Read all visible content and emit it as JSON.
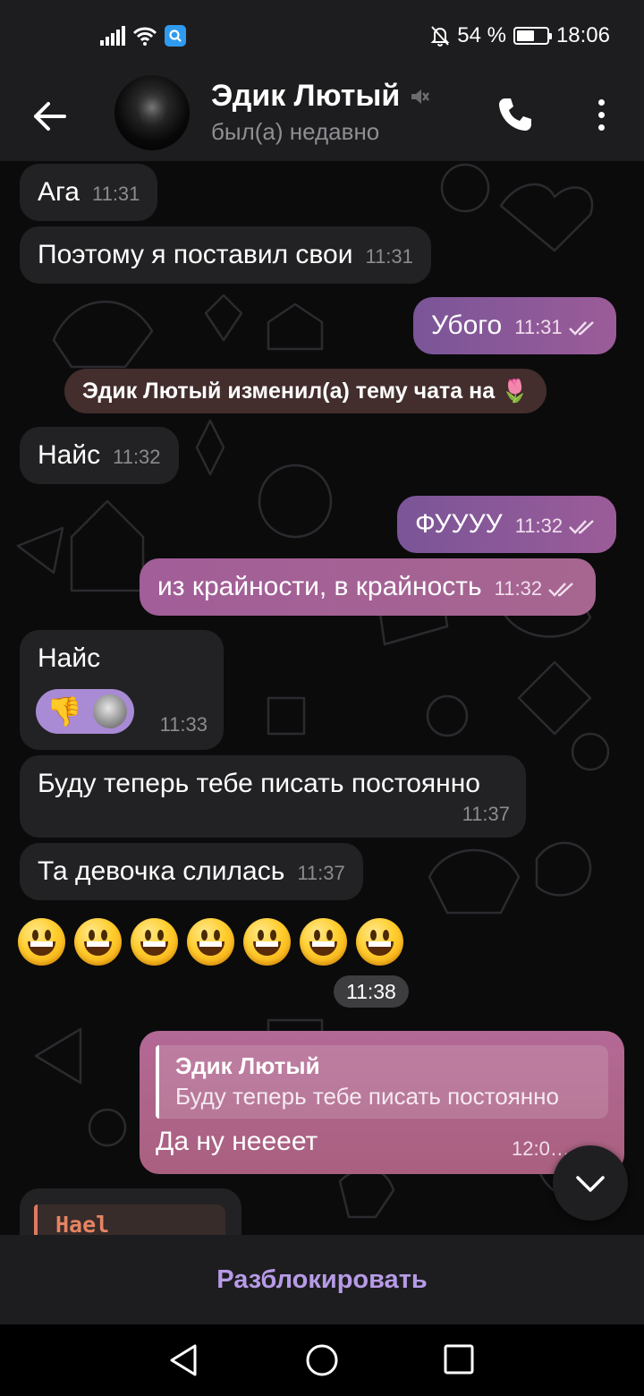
{
  "status_bar": {
    "battery_percent": "54 %",
    "time": "18:06"
  },
  "header": {
    "contact_name": "Эдик Лютый",
    "contact_status": "был(а) недавно",
    "muted": true
  },
  "messages": [
    {
      "dir": "in",
      "text": "Ага",
      "time": "11:31"
    },
    {
      "dir": "in",
      "text": "Поэтому я поставил свои",
      "time": "11:31"
    },
    {
      "dir": "out",
      "text": "Убого",
      "time": "11:31",
      "read": true
    },
    {
      "type": "service",
      "text": "Эдик Лютый изменил(а) тему чата на 🌷"
    },
    {
      "dir": "in",
      "text": "Найс",
      "time": "11:32"
    },
    {
      "dir": "out",
      "text": "ФУУУУ",
      "time": "11:32",
      "read": true
    },
    {
      "dir": "out",
      "text": "из крайности, в крайность",
      "time": "11:32",
      "read": true
    },
    {
      "dir": "in",
      "text": "Найс",
      "time": "11:33",
      "reaction": "👎"
    },
    {
      "dir": "in",
      "text": "Буду теперь тебе писать постоянно",
      "time": "11:37"
    },
    {
      "dir": "in",
      "text": "Та девочка слилась",
      "time": "11:37"
    },
    {
      "dir": "in",
      "type": "emoji",
      "emoji_count": 7,
      "time": "11:38"
    },
    {
      "dir": "out",
      "text": "Да ну нееeет",
      "time": "12:0…",
      "reply_to": {
        "name": "Эдик Лютый",
        "text": "Буду теперь тебе писать постоянно"
      }
    },
    {
      "dir": "in",
      "reply_to": {
        "name": "Hael"
      }
    }
  ],
  "bottom_bar": {
    "unblock_label": "Разблокировать"
  },
  "colors": {
    "background": "#0b0b0c",
    "incoming_bubble": "#222224",
    "outgoing_bubble_start": "#7a5598",
    "outgoing_bubble_end": "#a9607f",
    "accent": "#b79be6",
    "reaction_pill": "#a98ad4",
    "hael_color": "#e58463"
  },
  "icons": [
    "back-arrow-icon",
    "mute-icon",
    "phone-icon",
    "more-vertical-icon",
    "double-check-icon",
    "chevron-down-icon",
    "nav-back-icon",
    "nav-home-icon",
    "nav-recents-icon"
  ]
}
